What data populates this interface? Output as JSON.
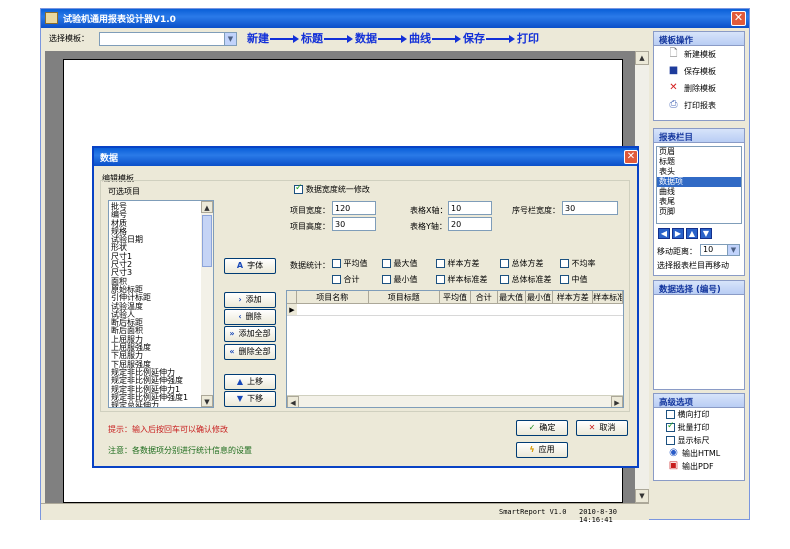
{
  "app": {
    "title": "试验机通用报表设计器V1.0",
    "close": "✕"
  },
  "toolbar": {
    "select_label": "选择模板：",
    "template_value": "",
    "flow": [
      "新建",
      "标题",
      "数据",
      "曲线",
      "保存",
      "打印"
    ]
  },
  "status": {
    "product": "SmartReport V1.0",
    "datetime": "2010-8-30 14:16:41"
  },
  "side": {
    "template_ops": {
      "heading": "模板操作",
      "items": [
        {
          "label": "新建模板",
          "icon": "new-document-icon"
        },
        {
          "label": "保存模板",
          "icon": "save-icon"
        },
        {
          "label": "删除模板",
          "icon": "delete-icon"
        },
        {
          "label": "打印报表",
          "icon": "printer-icon"
        }
      ]
    },
    "sections": {
      "heading": "报表栏目",
      "items": [
        "页眉",
        "标题",
        "表头",
        "数据项",
        "曲线",
        "表尾",
        "页脚"
      ],
      "selected_index": 3,
      "move_label": "移动距离：",
      "move_value": "10",
      "note": "选择报表栏目再移动"
    },
    "data_select": {
      "heading": "数据选择 (编号)"
    },
    "advanced": {
      "heading": "高级选项",
      "options": [
        {
          "label": "横向打印",
          "checked": false
        },
        {
          "label": "批量打印",
          "checked": true
        },
        {
          "label": "显示标尺",
          "checked": false
        }
      ],
      "exports": [
        {
          "label": "输出HTML",
          "icon": "html-export-icon"
        },
        {
          "label": "输出PDF",
          "icon": "pdf-export-icon"
        }
      ]
    }
  },
  "dialog": {
    "title": "数据",
    "group_label": "编辑模板",
    "available_label": "可选项目",
    "available_items": [
      "批号",
      "编号",
      "材质",
      "规格",
      "试验日期",
      "形状",
      "尺寸1",
      "尺寸2",
      "尺寸3",
      "面积",
      "原始标距",
      "引伸计标距",
      "试验温度",
      "试验人",
      "断后标距",
      "断后面积",
      "上屈服力",
      "上屈服强度",
      "下屈服力",
      "下屈服强度",
      "规定非比例延伸力",
      "规定非比例延伸强度",
      "规定非比例延伸力1",
      "规定非比例延伸强度1",
      "规定总延伸力"
    ],
    "uniform_width_label": "数据宽度统一修改",
    "uniform_width_checked": true,
    "fields": {
      "item_width_label": "项目宽度：",
      "item_width": "120",
      "table_x_label": "表格X轴：",
      "table_x": "10",
      "serial_width_label": "序号栏宽度：",
      "serial_width": "30",
      "item_height_label": "项目高度：",
      "item_height": "30",
      "table_y_label": "表格Y轴：",
      "table_y": "20"
    },
    "stats_label": "数据统计：",
    "stats": [
      "平均值",
      "最大值",
      "样本方差",
      "总体方差",
      "不均率",
      "合计",
      "最小值",
      "样本标准差",
      "总体标准差",
      "中值"
    ],
    "buttons": {
      "font": "字体",
      "add": "添加",
      "remove": "删除",
      "add_all": "添加全部",
      "remove_all": "删除全部",
      "move_up": "上移",
      "move_down": "下移",
      "ok": "确定",
      "cancel": "取消",
      "apply": "应用"
    },
    "grid_columns": [
      "项目名称",
      "项目标题",
      "平均值",
      "合计",
      "最大值",
      "最小值",
      "样本方差",
      "样本标准差"
    ],
    "hint": "提示：输入后按回车可以确认修改",
    "note": "注意：各数据项分别进行统计信息的设置"
  }
}
